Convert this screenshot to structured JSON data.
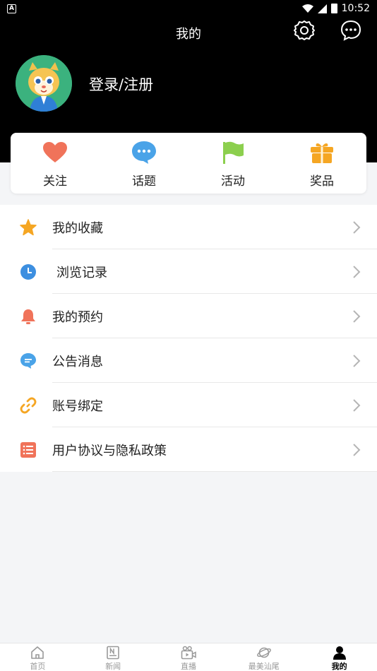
{
  "status_bar": {
    "time": "10:52",
    "app_badge": "A"
  },
  "header": {
    "title": "我的",
    "settings_icon": "gear-icon",
    "message_icon": "chat-bubble-icon"
  },
  "profile": {
    "login_label": "登录/注册"
  },
  "quick_actions": [
    {
      "label": "关注",
      "icon": "heart-icon",
      "color": "#f0735a"
    },
    {
      "label": "话题",
      "icon": "speech-bubble-icon",
      "color": "#4aa3e8"
    },
    {
      "label": "活动",
      "icon": "flag-icon",
      "color": "#8ccf4e"
    },
    {
      "label": "奖品",
      "icon": "gift-icon",
      "color": "#f5a623"
    }
  ],
  "menu": [
    {
      "label": "我的收藏",
      "icon": "star-icon",
      "color": "#f5a623"
    },
    {
      "label": "浏览记录",
      "icon": "clock-icon",
      "color": "#3d8fe0"
    },
    {
      "label": "我的预约",
      "icon": "bell-icon",
      "color": "#f0735a"
    },
    {
      "label": "公告消息",
      "icon": "message-icon",
      "color": "#4aa3e8"
    },
    {
      "label": "账号绑定",
      "icon": "link-icon",
      "color": "#f5a623"
    },
    {
      "label": "用户协议与隐私政策",
      "icon": "document-list-icon",
      "color": "#f0735a"
    }
  ],
  "bottom_nav": [
    {
      "label": "首页",
      "icon": "home-icon",
      "active": false
    },
    {
      "label": "新闻",
      "icon": "news-icon",
      "active": false
    },
    {
      "label": "直播",
      "icon": "live-video-icon",
      "active": false
    },
    {
      "label": "最美汕尾",
      "icon": "planet-icon",
      "active": false
    },
    {
      "label": "我的",
      "icon": "person-icon",
      "active": true
    }
  ]
}
